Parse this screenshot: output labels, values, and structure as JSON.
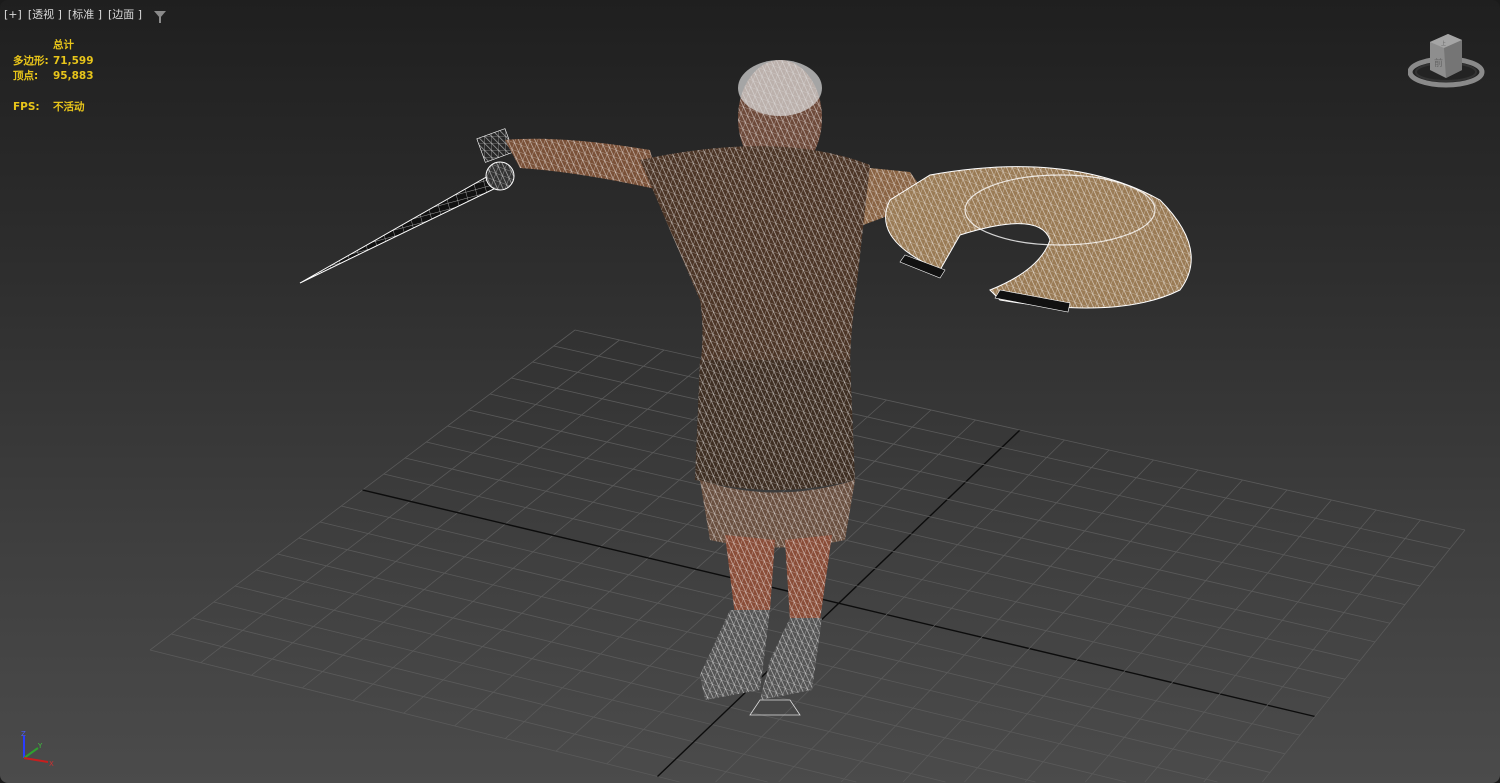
{
  "viewport": {
    "labels": [
      "[+]",
      "[透视 ]",
      "[标准 ]",
      "[边面 ]"
    ],
    "filter_icon": "filter-icon"
  },
  "stats": {
    "header": "总计",
    "polygons_label": "多边形:",
    "polygons_value": "71,599",
    "vertices_label": "顶点:",
    "vertices_value": "95,883",
    "fps_label": "FPS:",
    "fps_value": "不活动"
  },
  "viewcube": {
    "face_top": "上",
    "face_front": "前"
  },
  "axis_gizmo": {
    "x": "X",
    "y": "Y",
    "z": "Z"
  },
  "colors": {
    "stats": "#e8c51a",
    "mesh": "#ffffff",
    "skin": "#9a6a48",
    "gold": "#b89266"
  }
}
